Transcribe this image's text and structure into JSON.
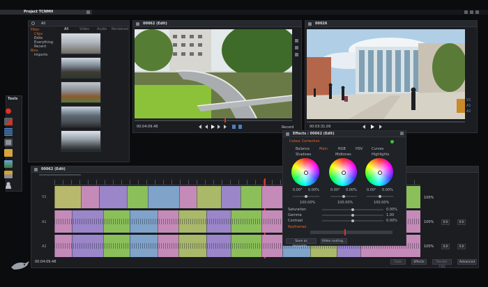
{
  "project": {
    "title": "Project TCNMH"
  },
  "browser": {
    "search": "All",
    "tree": [
      {
        "label": "Filter",
        "accent": true
      },
      {
        "label": "Clips",
        "accent": true
      },
      {
        "label": "Edits",
        "accent": false
      },
      {
        "label": "Everything",
        "accent": false
      },
      {
        "label": "Recent",
        "accent": false
      },
      {
        "label": "Bins",
        "accent": true
      },
      {
        "label": "Imports",
        "accent": false
      }
    ],
    "tabs": [
      "All",
      "Video",
      "Audio",
      "Rendered"
    ]
  },
  "tools": {
    "title": "Tools"
  },
  "source_viewer": {
    "title": "00062 (Edit)",
    "timecode": "00:04:09.48",
    "record_label": "Record"
  },
  "record_viewer": {
    "title": "00026",
    "timecode": "00:03:31.09",
    "side_labels": [
      "V1",
      "A1",
      "A2"
    ]
  },
  "effects": {
    "title": "Effects : 00062 (Edit)",
    "section": "Colour Correction",
    "tabs": [
      "Balance",
      "Main",
      "RGB",
      "HSV",
      "Curves"
    ],
    "active_tab": "Main",
    "wheels": [
      {
        "label": "Shadows",
        "values": [
          "0.00°",
          "0.00%"
        ],
        "scale": "100.00%"
      },
      {
        "label": "Midtones",
        "values": [
          "0.00°",
          "0.00%"
        ],
        "scale": "100.00%"
      },
      {
        "label": "Highlights",
        "values": [
          "0.00°",
          "0.00%"
        ],
        "scale": "100.00%"
      }
    ],
    "params": [
      {
        "label": "Saturation",
        "value": "0.00%"
      },
      {
        "label": "Gamma",
        "value": "1.00"
      },
      {
        "label": "Contrast",
        "value": "0.00%"
      }
    ],
    "keyframe_label": "Keyframes",
    "buttons": [
      "Save as template...",
      "Video routing..."
    ]
  },
  "timeline": {
    "title": "00062 (Edit)",
    "timecode": "00:04:09.48",
    "tracks": [
      {
        "label": "V1",
        "volume": "100%",
        "level": null
      },
      {
        "label": "A1",
        "volume": "100%",
        "level": "0.0"
      },
      {
        "label": "A2",
        "volume": "100%",
        "level": "0.0"
      }
    ],
    "footer_buttons": [
      "Fade",
      "Effects",
      "Render FXD",
      "Advanced"
    ]
  },
  "colors": {
    "accent": "#e86a2b",
    "clip_green": "#8bbf5a",
    "clip_pink": "#c58bb8",
    "clip_violet": "#9a86c9",
    "clip_blue": "#7fa3c9",
    "clip_olive": "#aab86a"
  },
  "icons": [
    "search-icon",
    "record-icon",
    "play-icon",
    "gear-icon",
    "folder-icon",
    "export-icon",
    "shark-logo-icon"
  ]
}
